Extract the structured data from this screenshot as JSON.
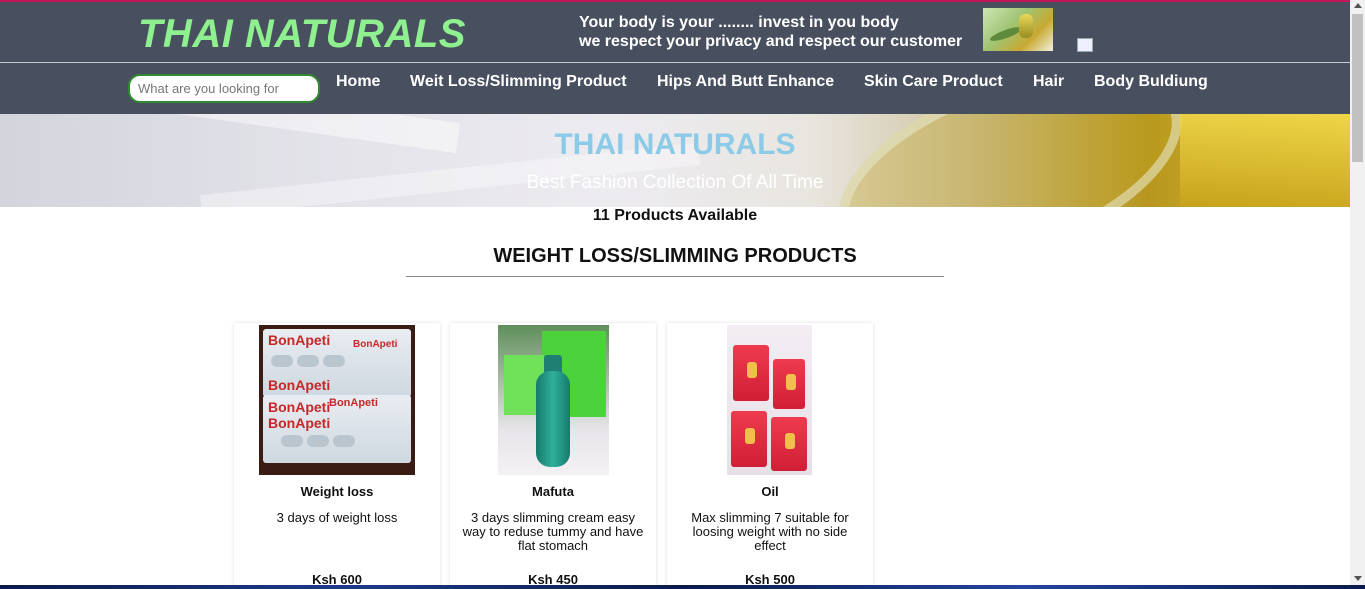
{
  "header": {
    "brand": "THAI NATURALS",
    "tagline_line1": "Your body is your ........ invest in you body",
    "tagline_line2": "we respect your privacy and respect our customer",
    "brand_color": "#8ef08e",
    "bar_color": "#485060"
  },
  "search": {
    "placeholder": "What are you looking for"
  },
  "nav": {
    "items": [
      {
        "label": "Home"
      },
      {
        "label": "Weit Loss/Slimming Product"
      },
      {
        "label": "Hips And Butt Enhance"
      },
      {
        "label": "Skin Care Product"
      },
      {
        "label": "Hair"
      },
      {
        "label": "Body Buldiung"
      }
    ]
  },
  "hero": {
    "title": "THAI NATURALS",
    "subtitle": "Best Fashion Collection Of All Time"
  },
  "catalog": {
    "count_text": "11 Products Available",
    "section_title": "WEIGHT LOSS/SLIMMING PRODUCTS",
    "products": [
      {
        "name": "Weight loss",
        "description": "3 days of weight loss",
        "price": "Ksh 600",
        "image_text_primary": "BonApeti",
        "image_text_secondary": "BonApeti"
      },
      {
        "name": "Mafuta",
        "description": "3 days slimming cream easy way to reduse tummy and have flat stomach",
        "price": "Ksh 450"
      },
      {
        "name": "Oil",
        "description": "Max slimming 7 suitable for loosing weight with no side effect",
        "price": "Ksh 500"
      }
    ]
  }
}
